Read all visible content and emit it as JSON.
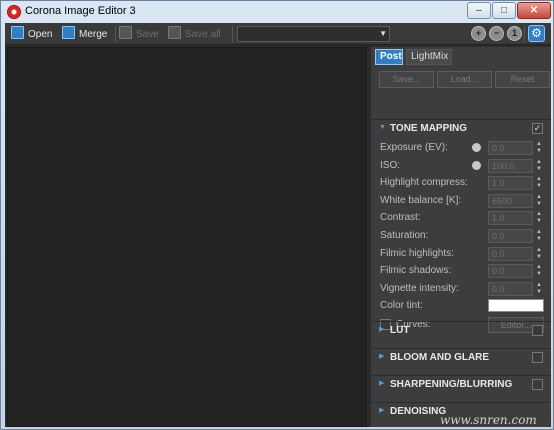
{
  "window": {
    "title": "Corona Image Editor 3",
    "min_glyph": "–",
    "max_glyph": "□",
    "close_glyph": "✕"
  },
  "toolbar": {
    "open_label": "Open",
    "merge_label": "Merge",
    "save_label": "Save",
    "save_all_label": "Save all",
    "combo_value": "",
    "zoom_in_glyph": "+",
    "zoom_out_glyph": "−",
    "zoom_fit_glyph": "1",
    "settings_glyph": "⚙"
  },
  "panel": {
    "tabs": [
      {
        "label": "Post",
        "active": true
      },
      {
        "label": "LightMix",
        "active": false
      }
    ],
    "preset_buttons": {
      "save": "Save...",
      "load": "Load...",
      "reset": "Reset"
    },
    "tone_mapping": {
      "title": "TONE MAPPING",
      "enabled_glyph": "✓",
      "rows": [
        {
          "label": "Exposure (EV):",
          "value": "0.0"
        },
        {
          "label": "ISO:",
          "value": "100.0"
        },
        {
          "label": "Highlight compress:",
          "value": "1.0"
        },
        {
          "label": "White balance [K]:",
          "value": "6500"
        },
        {
          "label": "Contrast:",
          "value": "1.0"
        },
        {
          "label": "Saturation:",
          "value": "0.0"
        },
        {
          "label": "Filmic highlights:",
          "value": "0.0"
        },
        {
          "label": "Filmic shadows:",
          "value": "0.0"
        },
        {
          "label": "Vignette intensity:",
          "value": "0.0"
        }
      ],
      "color_tint_label": "Color tint:",
      "color_tint_value": "#ffffff",
      "curves_label": "Curves:",
      "curves_button": "Editor..."
    },
    "sections": [
      {
        "title": "LUT"
      },
      {
        "title": "BLOOM AND GLARE"
      },
      {
        "title": "SHARPENING/BLURRING"
      },
      {
        "title": "DENOISING"
      }
    ]
  },
  "watermark": "www.snren.com",
  "colors": {
    "accent": "#2f7fc7",
    "panel_bg": "#3d3d3d",
    "canvas_bg": "#222222"
  }
}
